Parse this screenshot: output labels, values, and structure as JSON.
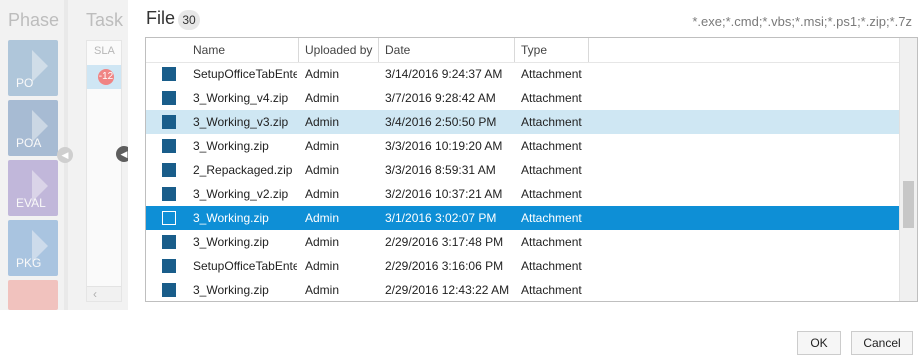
{
  "background": {
    "phase_title": "Phase",
    "task_title": "Task",
    "phases": [
      {
        "label": "PO",
        "color": "#7aa3c8"
      },
      {
        "label": "POA",
        "color": "#6a8fba"
      },
      {
        "label": "EVAL",
        "color": "#9a88c7"
      },
      {
        "label": "PKG",
        "color": "#6f9fd2"
      },
      {
        "label": "",
        "color": "#f09a93"
      }
    ],
    "task_sla_header": "SLA",
    "task_badge": "-12"
  },
  "modal": {
    "title": "File",
    "count": "30",
    "filter": "*.exe;*.cmd;*.vbs;*.msi;*.ps1;*.zip;*.7z",
    "columns": [
      "Name",
      "Uploaded by",
      "Date",
      "Type"
    ],
    "rows": [
      {
        "name": "SetupOfficeTabEnte",
        "uploaded_by": "Admin",
        "date": "3/14/2016 9:24:37 AM",
        "type": "Attachment",
        "state": ""
      },
      {
        "name": "3_Working_v4.zip",
        "uploaded_by": "Admin",
        "date": "3/7/2016 9:28:42 AM",
        "type": "Attachment",
        "state": ""
      },
      {
        "name": "3_Working_v3.zip",
        "uploaded_by": "Admin",
        "date": "3/4/2016 2:50:50 PM",
        "type": "Attachment",
        "state": "hover"
      },
      {
        "name": "3_Working.zip",
        "uploaded_by": "Admin",
        "date": "3/3/2016 10:19:20 AM",
        "type": "Attachment",
        "state": ""
      },
      {
        "name": "2_Repackaged.zip",
        "uploaded_by": "Admin",
        "date": "3/3/2016 8:59:31 AM",
        "type": "Attachment",
        "state": ""
      },
      {
        "name": "3_Working_v2.zip",
        "uploaded_by": "Admin",
        "date": "3/2/2016 10:37:21 AM",
        "type": "Attachment",
        "state": ""
      },
      {
        "name": "3_Working.zip",
        "uploaded_by": "Admin",
        "date": "3/1/2016 3:02:07 PM",
        "type": "Attachment",
        "state": "selected"
      },
      {
        "name": "3_Working.zip",
        "uploaded_by": "Admin",
        "date": "2/29/2016 3:17:48 PM",
        "type": "Attachment",
        "state": ""
      },
      {
        "name": "SetupOfficeTabEnte",
        "uploaded_by": "Admin",
        "date": "2/29/2016 3:16:06 PM",
        "type": "Attachment",
        "state": ""
      },
      {
        "name": "3_Working.zip",
        "uploaded_by": "Admin",
        "date": "2/29/2016 12:43:22 AM",
        "type": "Attachment",
        "state": ""
      }
    ],
    "ok_label": "OK",
    "cancel_label": "Cancel"
  },
  "colors": {
    "selected_row": "#0e8fd6",
    "hover_row": "#cfe7f3",
    "file_icon": "#195d8a"
  }
}
